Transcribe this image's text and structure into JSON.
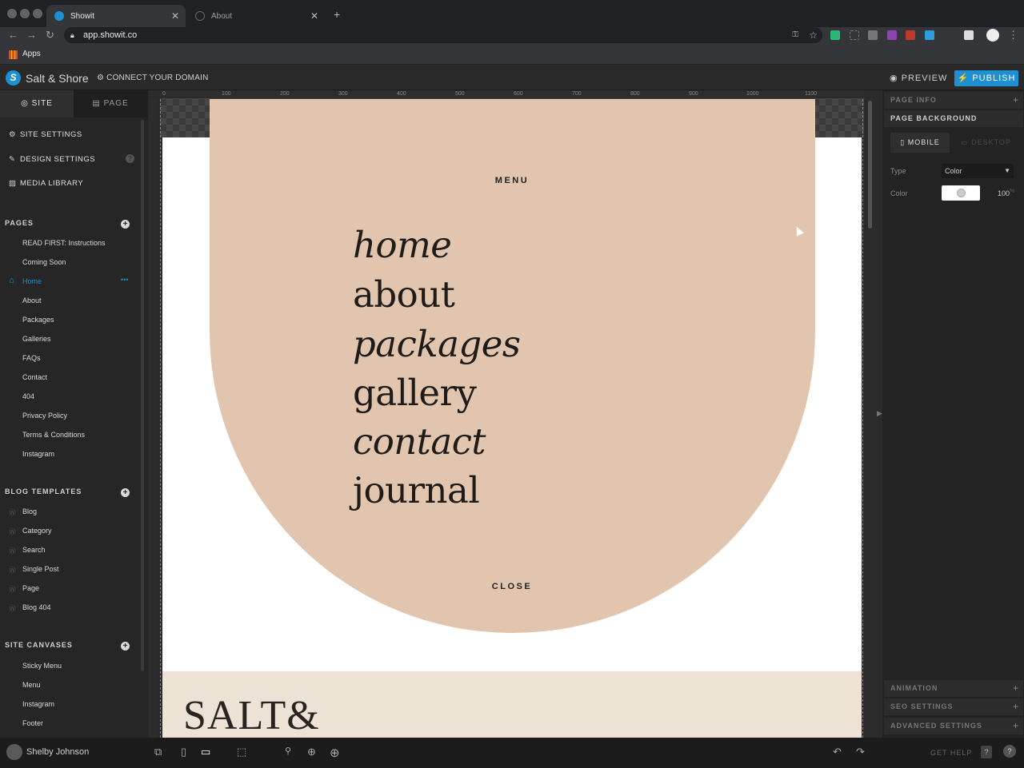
{
  "browser": {
    "tabs": [
      {
        "title": "Showit",
        "active": true
      },
      {
        "title": "About",
        "active": false
      }
    ],
    "url": "app.showit.co",
    "bookmarks_label": "Apps"
  },
  "app": {
    "site_name": "Salt & Shore",
    "connect_domain": "CONNECT YOUR DOMAIN",
    "preview_label": "PREVIEW",
    "publish_label": "PUBLISH",
    "accent": "#1e8fd0"
  },
  "sidebar": {
    "tab_site": "SITE",
    "tab_page": "PAGE",
    "options": [
      {
        "label": "SITE SETTINGS",
        "icon": "gear-icon"
      },
      {
        "label": "DESIGN SETTINGS",
        "icon": "brush-icon"
      },
      {
        "label": "MEDIA LIBRARY",
        "icon": "image-icon"
      }
    ],
    "help_badge": "?",
    "pages_header": "PAGES",
    "pages": [
      "READ FIRST: Instructions",
      "Coming Soon",
      "Home",
      "About",
      "Packages",
      "Galleries",
      "FAQs",
      "Contact",
      "404",
      "Privacy Policy",
      "Terms & Conditions",
      "Instagram"
    ],
    "active_page": "Home",
    "active_more": "•••",
    "blog_header": "BLOG TEMPLATES",
    "blog_templates": [
      "Blog",
      "Category",
      "Search",
      "Single Post",
      "Page",
      "Blog 404"
    ],
    "canvases_header": "SITE CANVASES",
    "canvases": [
      "Sticky Menu",
      "Menu",
      "Instagram",
      "Footer"
    ]
  },
  "canvas": {
    "ruler_ticks": [
      "0",
      "100",
      "200",
      "300",
      "400",
      "500",
      "600",
      "700",
      "800",
      "900",
      "1000",
      "1100"
    ],
    "menu_label": "MENU",
    "close_label": "CLOSE",
    "menu_items": [
      "home",
      "about",
      "packages",
      "gallery",
      "contact",
      "journal"
    ],
    "footer_wordmark": "SALT&",
    "arch_color": "#e2c5ae",
    "footer_color": "#ede2d6"
  },
  "right_panel": {
    "page_info": "PAGE INFO",
    "page_background": "PAGE BACKGROUND",
    "tab_mobile": "MOBILE",
    "tab_desktop": "DESKTOP",
    "type_label": "Type",
    "type_value": "Color",
    "color_label": "Color",
    "opacity_value": "100",
    "opacity_unit": "%",
    "animation": "ANIMATION",
    "seo_settings": "SEO SETTINGS",
    "advanced_settings": "ADVANCED SETTINGS"
  },
  "bottom_bar": {
    "user_name": "Shelby Johnson",
    "get_help": "GET HELP"
  }
}
